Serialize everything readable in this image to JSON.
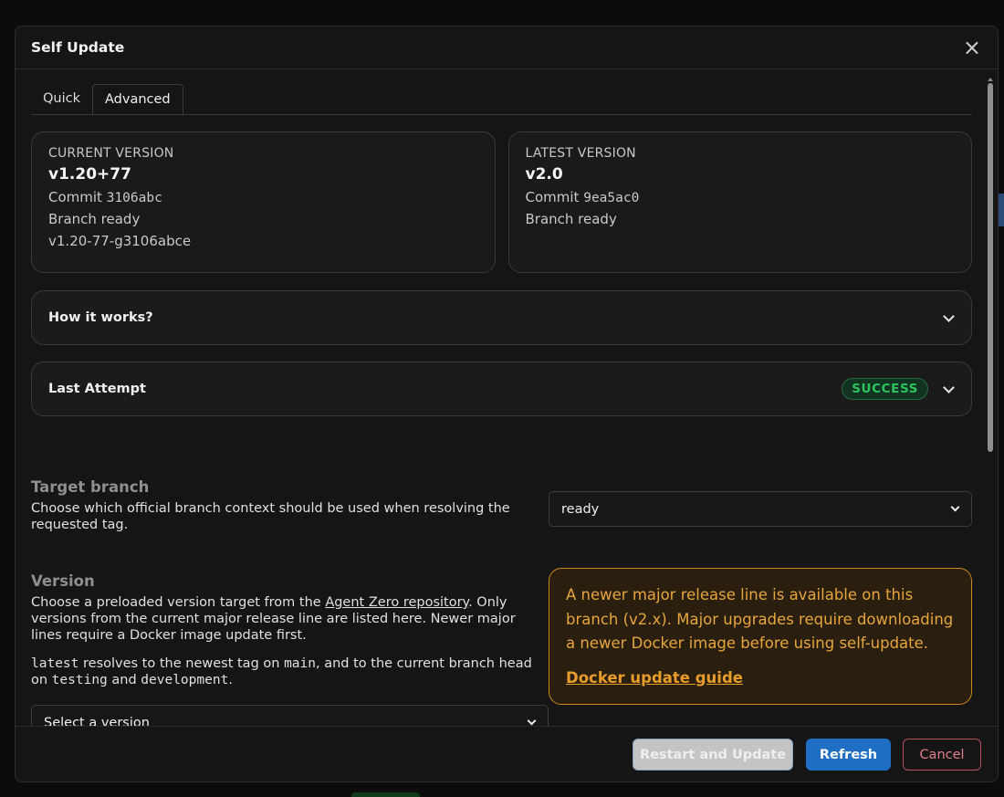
{
  "dialog": {
    "title": "Self Update",
    "close_glyph": "×"
  },
  "tabs": [
    {
      "label": "Quick"
    },
    {
      "label": "Advanced"
    }
  ],
  "current_version": {
    "label": "CURRENT VERSION",
    "version": "v1.20+77",
    "commit_prefix": "Commit",
    "commit": "3106abc",
    "branch": "Branch ready",
    "describe": "v1.20-77-g3106abce"
  },
  "latest_version": {
    "label": "LATEST VERSION",
    "version": "v2.0",
    "commit_prefix": "Commit",
    "commit": "9ea5ac0",
    "branch": "Branch ready"
  },
  "accordions": {
    "how_it_works": {
      "title": "How it works?"
    },
    "last_attempt": {
      "title": "Last Attempt",
      "status": "SUCCESS"
    }
  },
  "target_branch": {
    "title": "Target branch",
    "description": "Choose which official branch context should be used when resolving the requested tag.",
    "selected": "ready"
  },
  "version": {
    "title": "Version",
    "desc_before_link": "Choose a preloaded version target from the ",
    "link_text": "Agent Zero repository",
    "desc_after_link": ". Only versions from the current major release line are listed here. Newer major lines require a Docker image update first.",
    "note_code_latest": "latest",
    "note_text_1": " resolves to the newest tag on ",
    "note_code_main": "main",
    "note_text_2": ", and to the current branch head on ",
    "note_code_testing": "testing",
    "note_text_3": " and ",
    "note_code_development": "development",
    "note_text_4": ".",
    "select_placeholder": "Select a version"
  },
  "warning": {
    "text": "A newer major release line is available on this branch (v2.x). Major upgrades require downloading a newer Docker image before using self-update.",
    "link": "Docker update guide",
    "color": "#e6a53d"
  },
  "footer": {
    "restart_label": "Restart and Update",
    "refresh_label": "Refresh",
    "cancel_label": "Cancel"
  },
  "colors": {
    "accent": "#1e6fc4",
    "success": "#2fc35c",
    "danger": "#e07f8a"
  }
}
